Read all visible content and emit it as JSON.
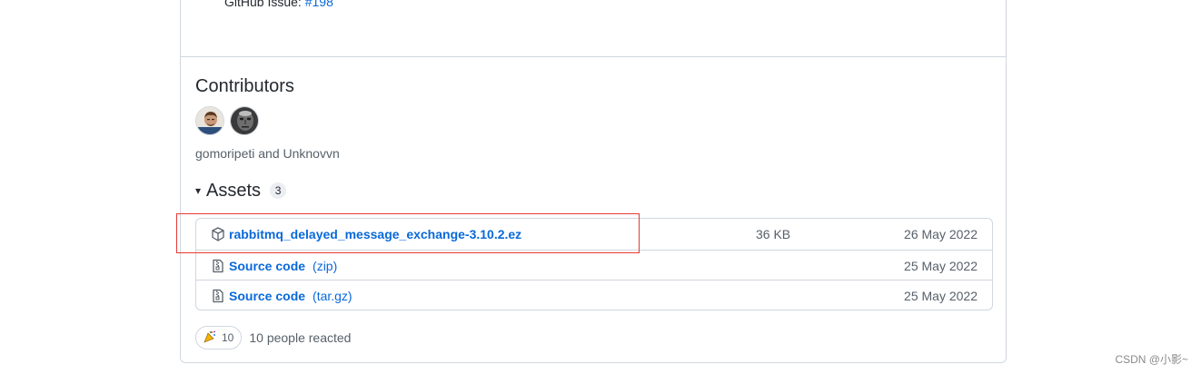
{
  "release": {
    "issue_prefix": "GitHub Issue:",
    "issue_link": "#198"
  },
  "contributors": {
    "title": "Contributors",
    "names": "gomoripeti and Unknovvn",
    "avatars": [
      {
        "alt": "gomoripeti"
      },
      {
        "alt": "Unknovvn"
      }
    ]
  },
  "assets": {
    "title": "Assets",
    "count": "3",
    "rows": [
      {
        "label": "rabbitmq_delayed_message_exchange-3.10.2.ez",
        "ext": "",
        "size": "36 KB",
        "date": "26 May 2022",
        "icon": "package-icon"
      },
      {
        "label": "Source code",
        "ext": "(zip)",
        "size": "",
        "date": "25 May 2022",
        "icon": "file-zip-icon"
      },
      {
        "label": "Source code",
        "ext": "(tar.gz)",
        "size": "",
        "date": "25 May 2022",
        "icon": "file-zip-icon"
      }
    ]
  },
  "reactions": {
    "count": "10",
    "summary": "10 people reacted",
    "emoji": "tada-icon"
  },
  "watermark": "CSDN @小影~",
  "colors": {
    "link": "#0969da",
    "highlight_box": "#e53935",
    "border": "#d0d7de"
  }
}
